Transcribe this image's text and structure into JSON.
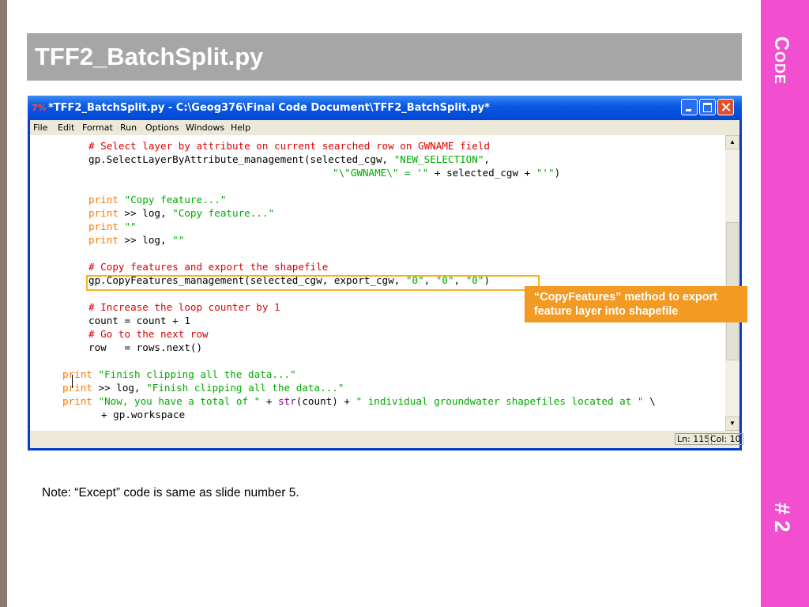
{
  "slide": {
    "title": "TFF2_BatchSplit.py",
    "side_label_top": "Code",
    "side_label_bottom": "# 2",
    "note": "Note: “Except” code is same as slide number 5.",
    "callout_line1": "“CopyFeatures” method to export",
    "callout_line2": "feature layer into shapefile"
  },
  "window": {
    "app_icon": "7%",
    "title": "*TFF2_BatchSplit.py - C:\\Geog376\\Final Code Document\\TFF2_BatchSplit.py*",
    "menu": [
      "File",
      "Edit",
      "Format",
      "Run",
      "Options",
      "Windows",
      "Help"
    ],
    "status_ln": "Ln: 115",
    "status_col": "Col: 10",
    "code": {
      "l1": "# Select layer by attribute on current searched row on GWNAME field",
      "l2a": "gp.SelectLayerByAttribute_management(selected_cgw, ",
      "l2b": "\"NEW_SELECTION\"",
      "l2c": ",",
      "l3a": "\"\\\"GWNAME\\\" = '\"",
      "l3b": " + selected_cgw + ",
      "l3c": "\"'\"",
      "l3d": ")",
      "l5a": "print",
      "l5b": " \"Copy feature...\"",
      "l6a": "print",
      "l6b": " >> log, ",
      "l6c": "\"Copy feature...\"",
      "l7a": "print",
      "l7b": " \"\"",
      "l8a": "print",
      "l8b": " >> log, ",
      "l8c": "\"\"",
      "l10": "# Copy features and export the shapefile",
      "l11a": "gp.CopyFeatures_management(selected_cgw, export_cgw, ",
      "l11b": "\"0\"",
      "l11c": ", ",
      "l11d": "\"0\"",
      "l11e": ", ",
      "l11f": "\"0\"",
      "l11g": ")",
      "l13": "# Increase the loop counter by 1",
      "l14": "count = count + 1",
      "l15": "# Go to the next row",
      "l16": "row   = rows.next()",
      "l18a": "print",
      "l18b": " \"Finish clipping all the data...\"",
      "l19a": "print",
      "l19b": " >> log, ",
      "l19c": "\"Finish clipping all the data...\"",
      "l20a": "print",
      "l20b": " \"Now, you have a total of \"",
      "l20c": " + ",
      "l20d": "str",
      "l20e": "(count) + ",
      "l20f": "\" individual groundwater shapefiles located at \"",
      "l20g": " \\",
      "l21": "+ gp.workspace"
    }
  },
  "colors": {
    "accent_pink": "#f24ed0",
    "title_gray": "#a6a6a6",
    "callout_orange": "#f39a23",
    "highlight_yellow": "#f3b322",
    "keyword": "#ff7700",
    "string": "#00aa00",
    "comment": "#dd0000",
    "builtin": "#900090"
  }
}
